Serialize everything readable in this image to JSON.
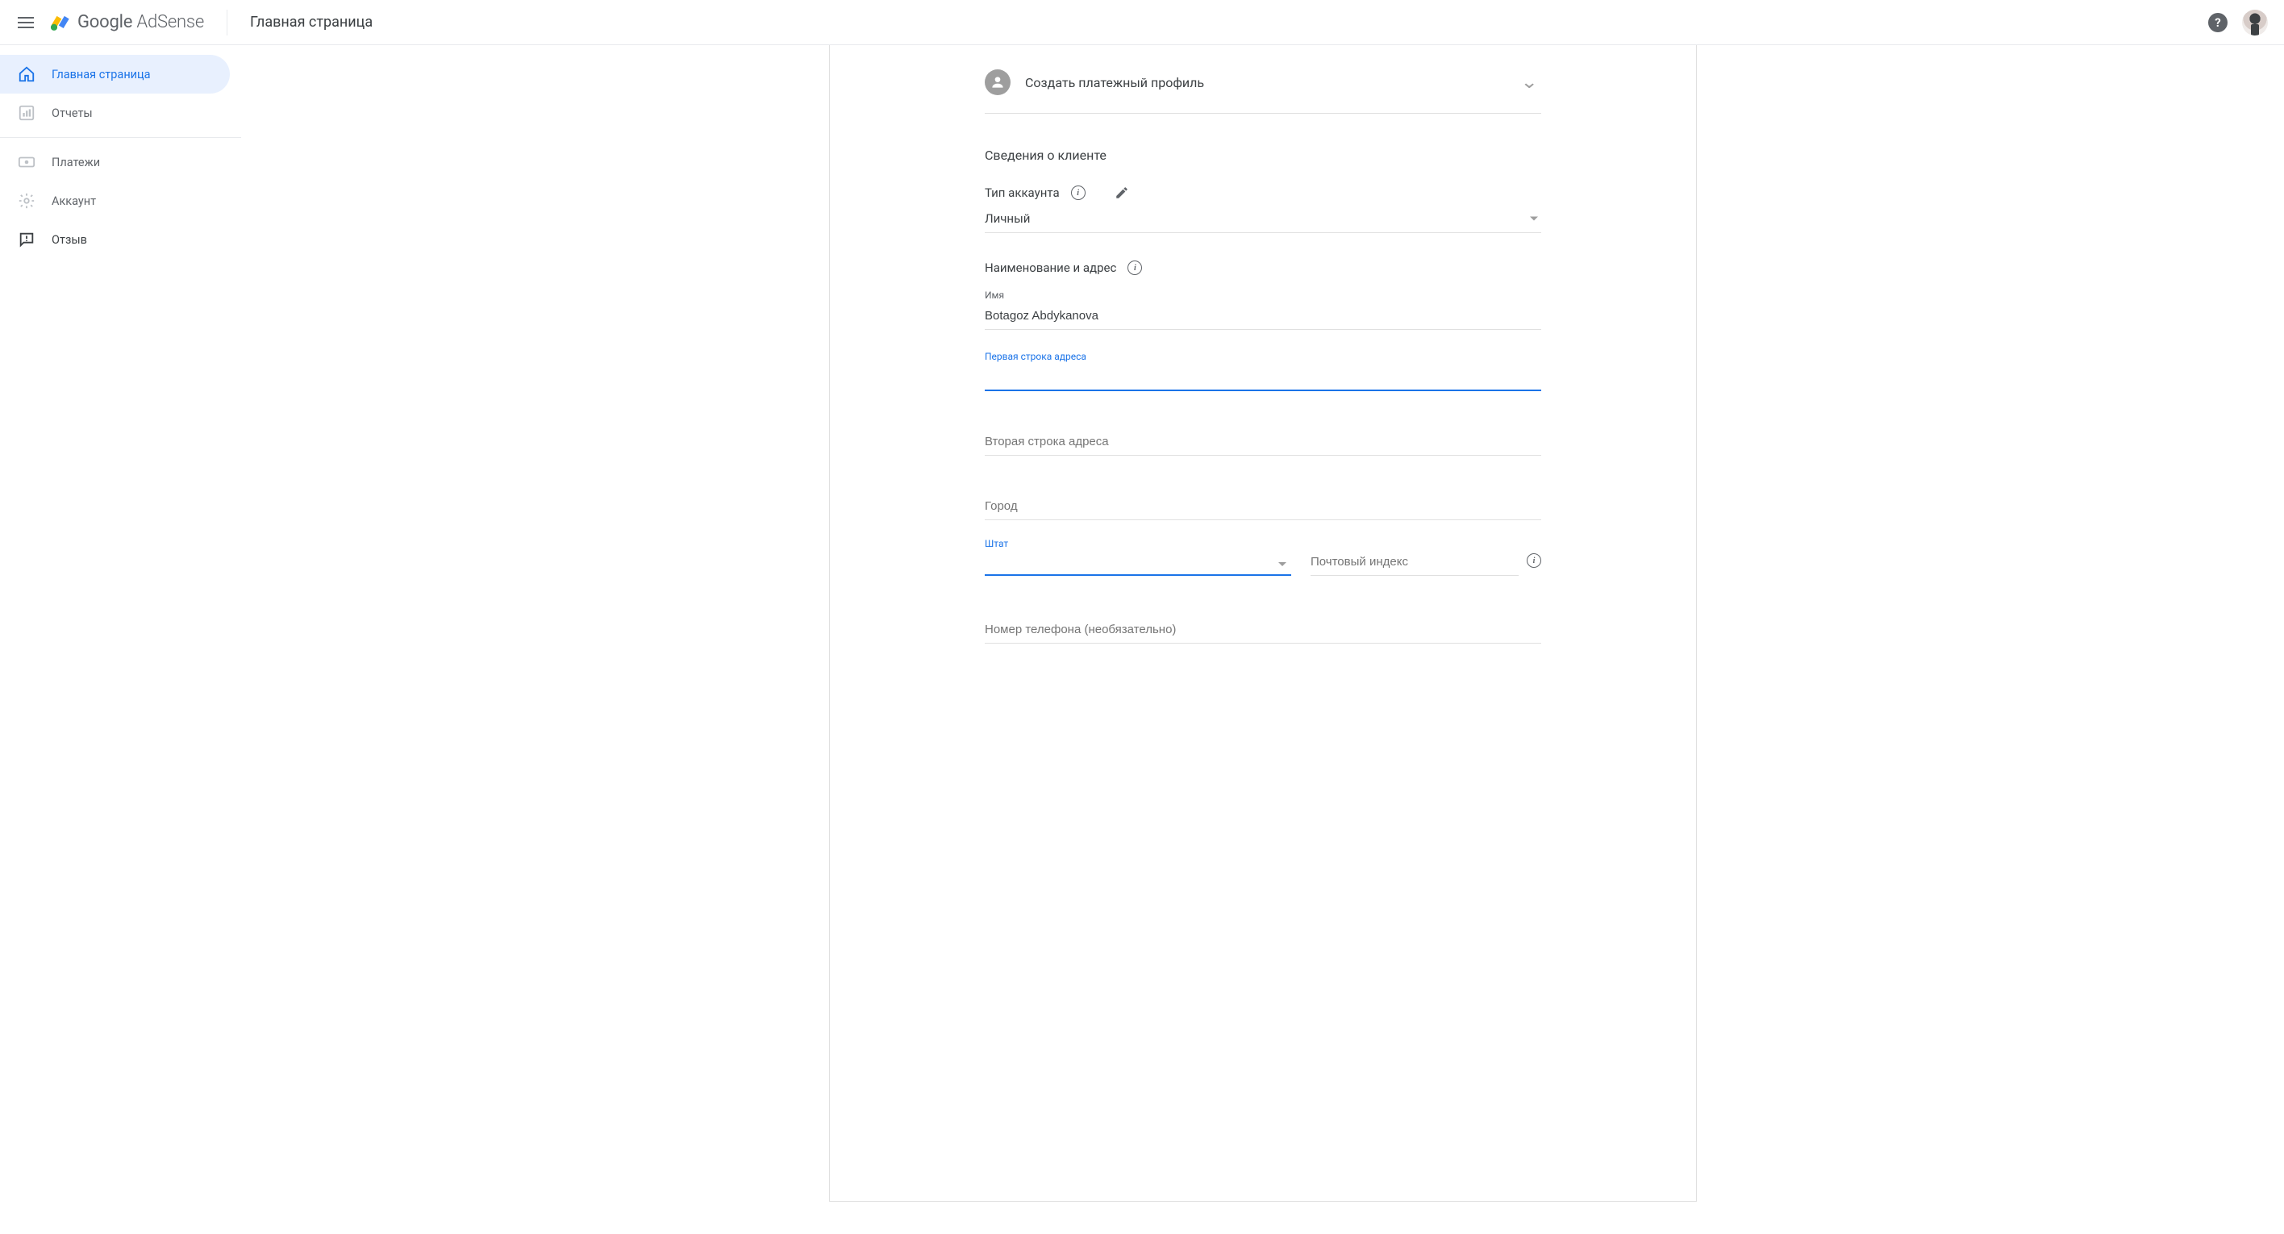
{
  "header": {
    "brand_google": "Google",
    "brand_adsense": " AdSense",
    "page_title": "Главная страница"
  },
  "sidebar": {
    "items": [
      {
        "label": "Главная страница"
      },
      {
        "label": "Отчеты"
      },
      {
        "label": "Платежи"
      },
      {
        "label": "Аккаунт"
      },
      {
        "label": "Отзыв"
      }
    ]
  },
  "form": {
    "profile_row_title": "Создать платежный профиль",
    "section_title": "Сведения о клиенте",
    "account_type": {
      "label": "Тип аккаунта",
      "value": "Личный"
    },
    "name_address_label": "Наименование и адрес",
    "name": {
      "label": "Имя",
      "value": "Botagoz Abdykanova"
    },
    "addr1": {
      "label": "Первая строка адреса",
      "value": ""
    },
    "addr2": {
      "placeholder": "Вторая строка адреса",
      "value": ""
    },
    "city": {
      "placeholder": "Город",
      "value": ""
    },
    "state": {
      "label": "Штат",
      "value": ""
    },
    "postal": {
      "placeholder": "Почтовый индекс",
      "value": ""
    },
    "phone": {
      "placeholder": "Номер телефона (необязательно)",
      "value": ""
    }
  }
}
